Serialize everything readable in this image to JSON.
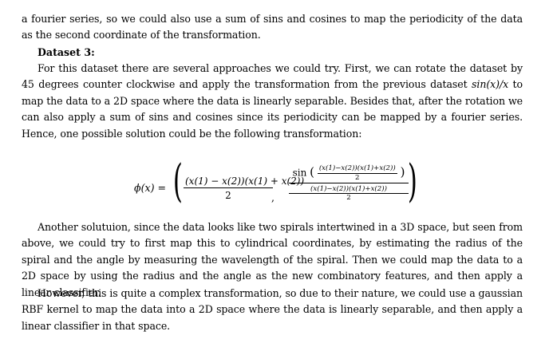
{
  "paragraphs": {
    "p1": "a fourier series, so we could also use a sum of sins and cosines to map the periodicity of the data as the second coordinate of the transformation.",
    "heading": "Dataset 3:",
    "p2_a": "For this dataset there are several approaches we could try. First, we can rotate the dataset by 45 degrees counter clockwise and apply the transformation from the previous dataset ",
    "p2_math": "sin(x)/x",
    "p2_b": " to map the data to a 2D space where the data is linearly separable. Besides that, after the rotation we can also apply a sum of sins and cosines since its periodicity can be mapped by a fourier series. Hence, one possible solution could be the following transformation:",
    "p3": "Another solutuion, since the data looks like two spirals intertwined in a 3D space, but seen from above, we could try to first map this to cylindrical coordinates, by estimating the radius of the spiral and the angle by measuring the wavelength of the spiral. Then we could map the data to a 2D space by using the radius and the angle as the new combinatory features, and then apply a linear classifier.",
    "p4": "However, this is quite a complex transformation, so due to their nature, we could use a gaussian RBF kernel to map the data into a 2D space where the data is linearly separable, and then apply a linear classifier in that space."
  },
  "equation": {
    "lhs": "ϕ(x) =",
    "frac1_num": "(x(1) − x(2))(x(1) + x(2))",
    "frac1_den": "2",
    "comma": ",",
    "sin": "sin",
    "inner_num": "(x(1)−x(2))(x(1)+x(2))",
    "inner_den": "2",
    "frac2_den": "(x(1)−x(2))(x(1)+x(2))",
    "frac2_den2": "2"
  }
}
